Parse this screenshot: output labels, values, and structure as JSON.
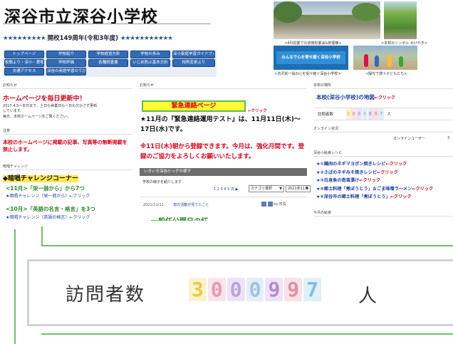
{
  "header": {
    "title": "深谷市立深谷小学校",
    "stars_left": "★★★★★★★★★",
    "anniversary": "開校149周年(令和3年度)",
    "stars_right": "★★★★★★★★★★★"
  },
  "nav": {
    "row1": [
      "トップページ",
      "学校紹介",
      "学校経営方針",
      "学校の歩み",
      "深小家庭学習ガイドブック"
    ],
    "row2": [
      "校歌より・深小・愛唱",
      "学校評価",
      "各種調査書",
      "いじめ防止基本方針",
      "校則変更より"
    ],
    "row3": [
      "交通アクセス",
      "深谷の英語学習のてびき"
    ]
  },
  "photos": {
    "caption1": "<4月授業での道徳授業会&管理棟>",
    "caption2": "<本校のシンボル 大けやき>",
    "banner_text": "みんなで心を寄せ磨く深谷小学校",
    "caption3": "<渋沢栄一翁の心を受け継ぐ深谷小学校>",
    "caption4": "<陽光で憩う子どもたち>"
  },
  "left": {
    "sec1_header": "お知らせ",
    "update_title": "ホームページを毎日更新中！",
    "update_body1": "2017.4.5〜本日まで、土日も休業日も一日も欠かさず更新",
    "update_body2": "しています。",
    "update_body3": "毎日、本校ホームページをご覧ください。",
    "sec2_header": "注意",
    "notice": "本校のホームページに掲載の記事、写真等の無断掲載を禁止します。",
    "sec3_header": "暗唱チャレンジ",
    "challenge_title": "◆暗唱チャレンジコーナー",
    "nov_line1": "<11月>「栄一翁から」から7つ",
    "nov_link1": "★暗唱チャレンジ（栄一翁から）←クリック",
    "oct_line": "<10月>「英語の名言・格言」を3つ",
    "oct_link": "★暗唱チャレンジ（英語の格言）←クリック"
  },
  "center": {
    "sec_header": "お知らせ",
    "banner": "緊急連絡ページ",
    "click": "←クリック",
    "main_text": "★11月の『緊急連絡運用テスト』は、11月11日(木)〜17日(水)です。",
    "red_text": "※11日(木)朝から登録できます。今月は、強化月間です。登録のご協力をよろしくお願いいたします。",
    "blog_header": "いきいき深谷小っ子の様子",
    "blog_intro": "学校の様子を紹介します",
    "pager": "1 2 3 4 5 次 ▶",
    "select_category": "カテゴリ選択",
    "select_month": "2021年11月",
    "post_date": "2021/11/11",
    "post_link": "前の活動が見てたこと",
    "post_tag": "by 校長",
    "post_title": "一般任公開日の紅"
  },
  "right": {
    "sec1_header": "本校の場所",
    "map_link": "本校(深谷小学校)の地図",
    "click": "←クリック",
    "counter_label": "訪問者数",
    "counter_digits": [
      "3",
      "0",
      "0",
      "0",
      "9",
      "9",
      "7"
    ],
    "counter_unit": "人",
    "sec2_header": "オンライン状況",
    "online_label": "オンラインユーザー",
    "online_count": "3",
    "sec3_header": "深谷小給食レシピ",
    "recipes": [
      {
        "text": "★①鶏肉のネギマヨポン焼きレシピ",
        "click": "←クリック"
      },
      {
        "text": "★②さばのネギみそ焼きレシピ",
        "click": "←クリック"
      },
      {
        "text": "★③白身魚の南蛮漬け",
        "click": "←クリック"
      },
      {
        "text": "★④郷土料理「煮ぼうとう」＆ごま味噌ラーメン",
        "click": "←クリック"
      },
      {
        "text": "★⑤深谷市の郷土料理「煮ぼうとう」",
        "click": "←クリック"
      }
    ],
    "sec4_header": "今月の給食"
  },
  "zoom": {
    "label": "訪問者数",
    "digits": [
      "3",
      "0",
      "0",
      "0",
      "9",
      "9",
      "7"
    ],
    "unit": "人"
  },
  "colors": {
    "nav_blue": "#2f6cb8",
    "link_blue": "#1a3ea0",
    "alert_red": "#e0001a",
    "banner_yellow": "#ffff33",
    "banner_green": "#5cb85c",
    "zoom_border": "#6fbf6a"
  }
}
